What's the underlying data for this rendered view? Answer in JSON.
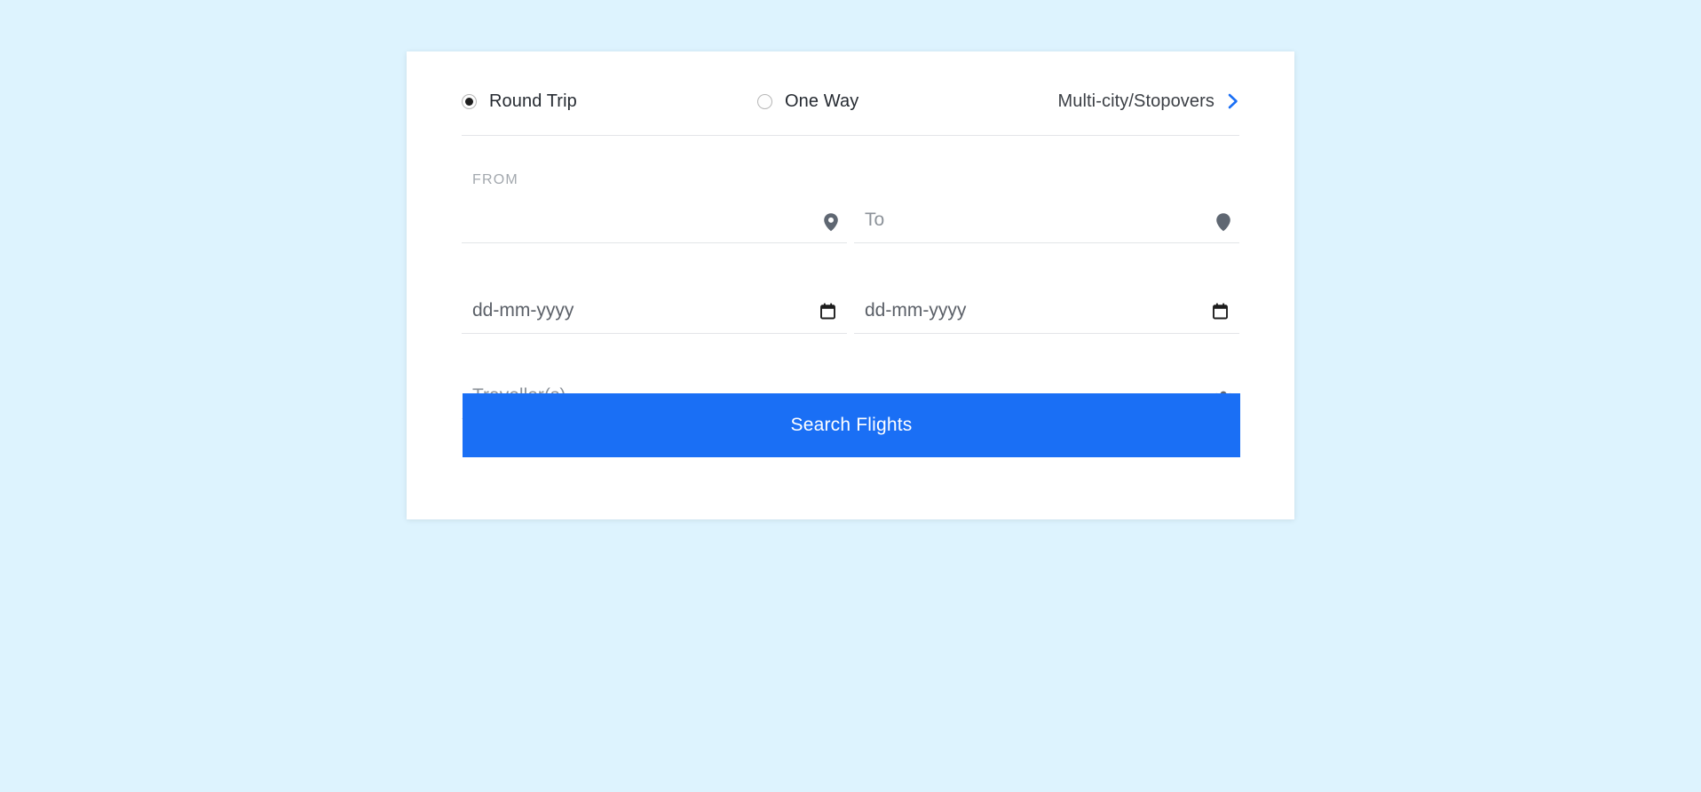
{
  "theme": {
    "page_background": "#ddf3fe",
    "card_background": "#ffffff",
    "accent": "#1a6ff5",
    "divider": "#e3e5e8",
    "placeholder_text": "#8c9299",
    "label_text": "#a3a8ae"
  },
  "trip_type": {
    "options": [
      {
        "label": "Round Trip",
        "value": "round-trip",
        "selected": true
      },
      {
        "label": "One Way",
        "value": "one-way",
        "selected": false
      }
    ],
    "multi_city": {
      "label": "Multi-city/Stopovers",
      "chevron_icon": "chevron-right-icon",
      "chevron_color": "#1a6ff5"
    }
  },
  "locations": {
    "from": {
      "floating_label": "FROM",
      "value": "",
      "placeholder": "",
      "icon": "location-dot-icon"
    },
    "to": {
      "floating_label": "",
      "value": "",
      "placeholder": "To",
      "icon": "map-pin-icon"
    }
  },
  "dates": {
    "depart": {
      "value": "",
      "placeholder": "dd-mm-yyyy",
      "icon": "calendar-icon"
    },
    "return": {
      "value": "",
      "placeholder": "dd-mm-yyyy",
      "icon": "calendar-icon"
    }
  },
  "travellers": {
    "value": "",
    "placeholder": "Traveller(s)",
    "icon": "users-group-icon"
  },
  "submit": {
    "label": "Search Flights"
  }
}
